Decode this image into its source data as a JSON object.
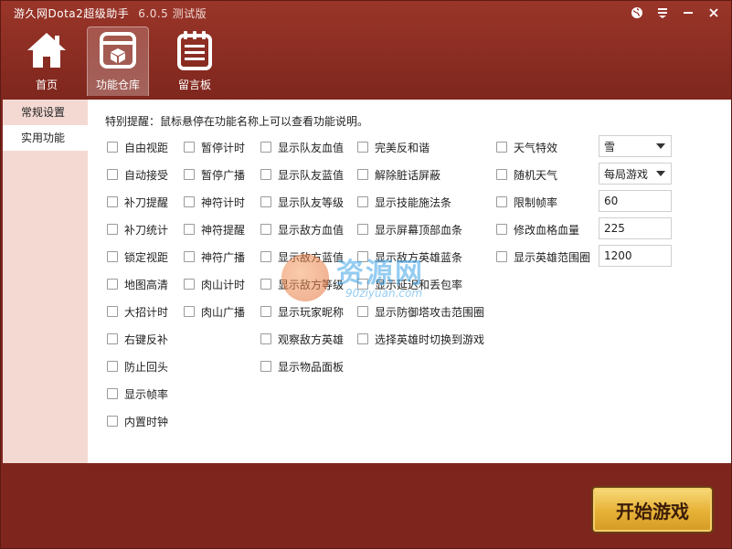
{
  "window": {
    "title": "游久网Dota2超级助手",
    "version": "6.0.5 测试版"
  },
  "window_buttons": [
    {
      "name": "globe-icon",
      "glyph": "◉"
    },
    {
      "name": "menu-icon",
      "glyph": "≡"
    },
    {
      "name": "minimize-icon",
      "glyph": "—"
    },
    {
      "name": "close-icon",
      "glyph": "✕"
    }
  ],
  "toolbar": {
    "home": "首页",
    "warehouse": "功能仓库",
    "board": "留言板"
  },
  "sidebar": {
    "items": [
      "常规设置",
      "实用功能"
    ]
  },
  "main": {
    "notice": "特别提醒：鼠标悬停在功能名称上可以查看功能说明。",
    "col1": [
      "自由视距",
      "自动接受",
      "补刀提醒",
      "补刀统计",
      "锁定视距",
      "地图高清",
      "大招计时",
      "右键反补",
      "防止回头",
      "显示帧率",
      "内置时钟"
    ],
    "col2": [
      "暂停计时",
      "暂停广播",
      "神符计时",
      "神符提醒",
      "神符广播",
      "肉山计时",
      "肉山广播"
    ],
    "col3": [
      "显示队友血值",
      "显示队友蓝值",
      "显示队友等级",
      "显示敌方血值",
      "显示敌方蓝值",
      "显示敌方等级",
      "显示玩家昵称",
      "观察敌方英雄",
      "显示物品面板"
    ],
    "col4": [
      "完美反和谐",
      "解除脏话屏蔽",
      "显示技能施法条",
      "显示屏幕顶部血条",
      "显示敌方英雄蓝条",
      "显示延迟和丢包率",
      "显示防御塔攻击范围圈",
      "选择英雄时切换到游戏"
    ],
    "col5": [
      "天气特效",
      "随机天气",
      "限制帧率",
      "修改血格血量",
      "显示英雄范围圈"
    ],
    "fields": {
      "weather": "雪",
      "random_weather": "每局游戏",
      "fps_limit": "60",
      "hp_block": "225",
      "hero_range": "1200"
    }
  },
  "watermark": {
    "text": "资源网",
    "url": "90ziyuan.com"
  },
  "start_button": "开始游戏"
}
